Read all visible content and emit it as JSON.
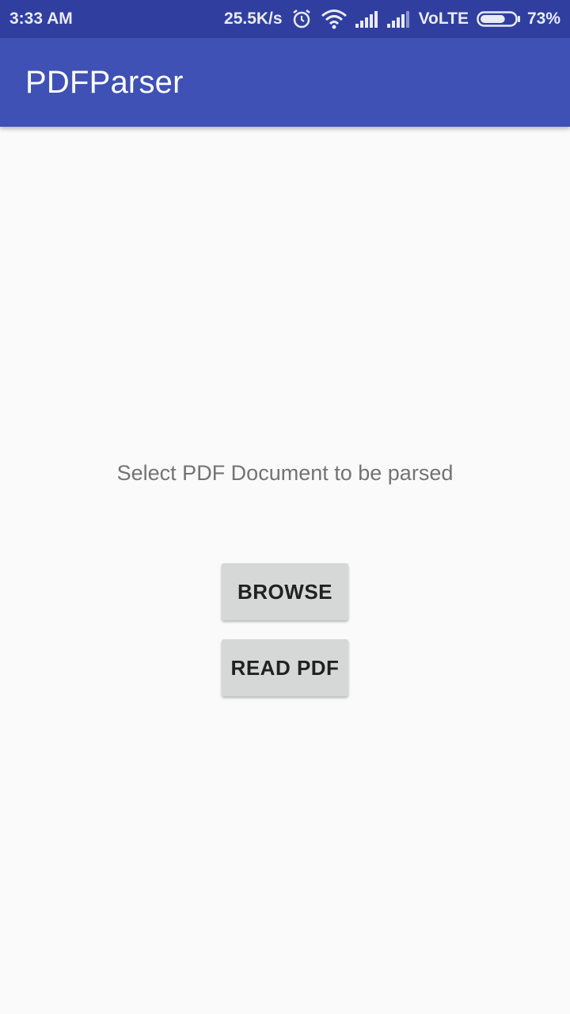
{
  "status_bar": {
    "time": "3:33 AM",
    "network_speed": "25.5K/s",
    "network_type": "VoLTE",
    "battery_percent": "73%",
    "battery_level": 0.73,
    "icons": [
      "alarm-icon",
      "wifi-icon",
      "signal-icon",
      "signal-icon",
      "battery-icon"
    ]
  },
  "app_bar": {
    "title": "PDFParser"
  },
  "main": {
    "prompt": "Select PDF Document to be parsed",
    "browse_label": "BROWSE",
    "read_label": "READ PDF"
  },
  "colors": {
    "status_bar": "#303f9f",
    "app_bar": "#3f51b5",
    "background": "#fafafa",
    "button": "#d6d7d7"
  }
}
